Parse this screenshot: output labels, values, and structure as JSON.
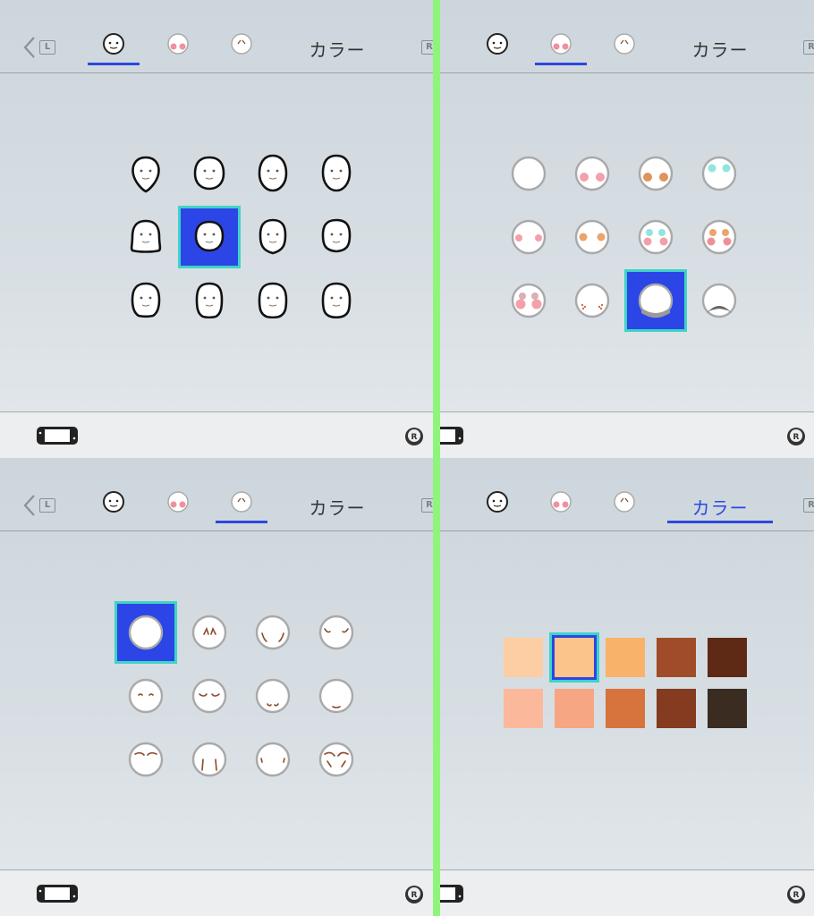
{
  "tabs": {
    "color_label": "カラー",
    "l_button": "L",
    "r_button": "R"
  },
  "icons": {
    "back": "chevron-left-icon",
    "face_shape": "face-shape-icon",
    "makeup": "makeup-icon",
    "wrinkles": "wrinkles-icon",
    "console": "switch-console-icon",
    "stick": "r-stick-icon"
  },
  "panels": [
    {
      "id": "face-shape",
      "active_tab": "face_shape",
      "items": [
        "shape-1",
        "shape-2",
        "shape-3",
        "shape-4",
        "shape-5",
        "shape-6",
        "shape-7",
        "shape-8",
        "shape-9",
        "shape-10",
        "shape-11",
        "shape-12"
      ],
      "selected_index": 5
    },
    {
      "id": "makeup",
      "active_tab": "makeup",
      "items": [
        "none",
        "pink-blush",
        "orange-blush",
        "cyan-eyeshadow",
        "pink-cheeks",
        "orange-cheeks",
        "cyan-and-pink",
        "orange-and-pink",
        "pink-heavy",
        "freckles",
        "beard-shadow",
        "mustache-shadow"
      ],
      "selected_index": 10
    },
    {
      "id": "wrinkles",
      "active_tab": "wrinkles",
      "items": [
        "none",
        "eye-lines",
        "cheek-lines",
        "forehead-lines",
        "under-eye-arcs",
        "sleepy-lids",
        "mouth-lines",
        "chin-line",
        "brow-lines",
        "nasolabial",
        "cheek-dots",
        "heavy-lines"
      ],
      "selected_index": 0
    },
    {
      "id": "skin-color",
      "active_tab": "color",
      "colors": [
        "#fdcda3",
        "#fbc48a",
        "#f8b26a",
        "#a04c28",
        "#5e2a16",
        "#fbb89a",
        "#f6a682",
        "#d7733c",
        "#843b1f",
        "#3b2c22"
      ],
      "selected_index": 1
    }
  ]
}
